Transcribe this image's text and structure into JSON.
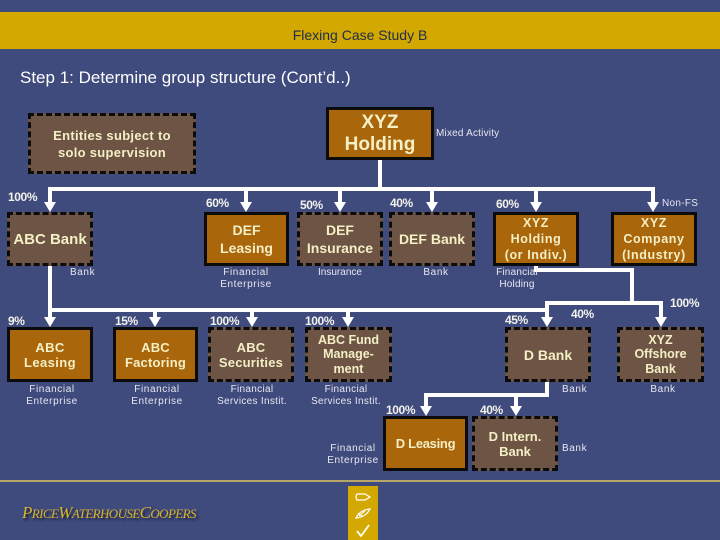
{
  "header": {
    "title": "Flexing Case Study B"
  },
  "slide": {
    "heading": "Step 1: Determine group structure (Cont’d..)"
  },
  "legend": {
    "label": "Entities subject to\nsolo supervision",
    "meaning": "dashed boxes = entities subject to solo supervision"
  },
  "entities": {
    "xyz_holding": {
      "name": "XYZ\nHolding",
      "category": "Mixed Activity",
      "solo_supervision": false
    },
    "abc_bank": {
      "name": "ABC Bank",
      "ownership": "100%",
      "category": "Bank",
      "solo_supervision": true
    },
    "def_leasing": {
      "name": "DEF\nLeasing",
      "ownership": "60%",
      "category": "Financial\nEnterprise",
      "solo_supervision": false
    },
    "def_insurance": {
      "name": "DEF\nInsurance",
      "ownership": "50%",
      "category": "Insurance",
      "solo_supervision": true
    },
    "def_bank": {
      "name": "DEF Bank",
      "ownership": "40%",
      "category": "Bank",
      "solo_supervision": true
    },
    "xyz_holding_indiv": {
      "name": "XYZ\nHolding\n(or Indiv.)",
      "ownership": "60%",
      "category": "Financial\nHolding",
      "solo_supervision": false
    },
    "xyz_company": {
      "name": "XYZ\nCompany\n(Industry)",
      "category": "Non-FS",
      "solo_supervision": false
    },
    "abc_leasing": {
      "name": "ABC\nLeasing",
      "ownership": "9%",
      "category": "Financial\nEnterprise",
      "solo_supervision": false
    },
    "abc_factoring": {
      "name": "ABC\nFactoring",
      "ownership": "15%",
      "category": "Financial\nEnterprise",
      "solo_supervision": false
    },
    "abc_securities": {
      "name": "ABC\nSecurities",
      "ownership": "100%",
      "category": "Financial\nServices Instit.",
      "solo_supervision": true
    },
    "abc_fund_management": {
      "name": "ABC Fund\nManage-\nment",
      "ownership": "100%",
      "category": "Financial\nServices Instit.",
      "solo_supervision": true
    },
    "d_bank": {
      "name": "D Bank",
      "ownership_from_abc_bank": "45%",
      "ownership_from_xyz_holding": "40%",
      "category": "Bank",
      "solo_supervision": true
    },
    "xyz_offshore_bank": {
      "name": "XYZ\nOffshore\nBank",
      "ownership": "100%",
      "category": "Bank",
      "solo_supervision": true
    },
    "d_leasing": {
      "name": "D Leasing",
      "ownership": "100%",
      "category": "Financial\nEnterprise",
      "solo_supervision": false
    },
    "d_intern_bank": {
      "name": "D Intern.\nBank",
      "ownership": "40%",
      "category": "Bank",
      "solo_supervision": true
    }
  },
  "relations": [
    {
      "parent": "XYZ Holding",
      "child": "ABC Bank",
      "percent": "100%"
    },
    {
      "parent": "XYZ Holding",
      "child": "DEF Leasing",
      "percent": "60%"
    },
    {
      "parent": "XYZ Holding",
      "child": "DEF Insurance",
      "percent": "50%"
    },
    {
      "parent": "XYZ Holding",
      "child": "DEF Bank",
      "percent": "40%"
    },
    {
      "parent": "XYZ Holding",
      "child": "XYZ Holding (or Indiv.)",
      "percent": "60%"
    },
    {
      "parent": "XYZ Holding",
      "child": "XYZ Company (Industry)",
      "percent": ""
    },
    {
      "parent": "ABC Bank",
      "child": "ABC Leasing",
      "percent": "9%"
    },
    {
      "parent": "ABC Bank",
      "child": "ABC Factoring",
      "percent": "15%"
    },
    {
      "parent": "ABC Bank",
      "child": "ABC Securities",
      "percent": "100%"
    },
    {
      "parent": "ABC Bank",
      "child": "ABC Fund Management",
      "percent": "100%"
    },
    {
      "parent": "ABC Bank",
      "child": "D Bank",
      "percent": "45%"
    },
    {
      "parent": "XYZ Holding (or Indiv.)",
      "child": "D Bank",
      "percent": "40%"
    },
    {
      "parent": "XYZ Holding (or Indiv.)",
      "child": "XYZ Offshore Bank",
      "percent": "100%"
    },
    {
      "parent": "D Bank",
      "child": "D Leasing",
      "percent": "100%"
    },
    {
      "parent": "D Bank",
      "child": "D Intern. Bank",
      "percent": "40%"
    }
  ],
  "toolbar": {
    "icons": [
      "arrow-outline-icon",
      "pencil-icon",
      "checkmark-icon"
    ]
  },
  "logo": {
    "first": "P",
    "rest1": "RICE",
    "w": "W",
    "rest2": "ATERHOUSE",
    "c": "C",
    "rest3": "OOPERS"
  },
  "colors": {
    "background": "#3f4a7d",
    "accent_gold": "#d3a800",
    "supervised_box": "#6d5444",
    "other_box": "#a9660b",
    "box_text": "#f4efc4"
  }
}
